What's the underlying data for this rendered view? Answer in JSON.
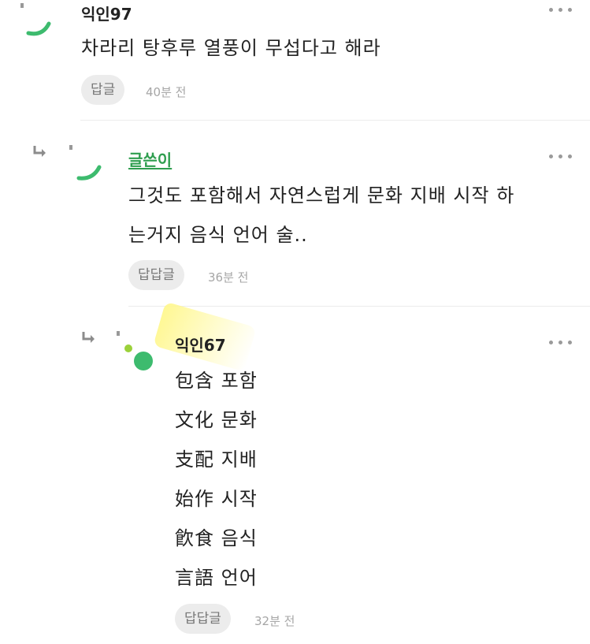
{
  "comments": [
    {
      "nickname": "익인97",
      "lines": [
        "차라리 탕후루 열풍이 무섭다고 해라"
      ],
      "reply_label": "답글",
      "time": "40분 전"
    },
    {
      "nickname": "글쓴이",
      "lines": [
        "그것도 포함해서 자연스럽게 문화 지배 시작 하",
        "는거지 음식 언어 술.."
      ],
      "reply_label": "답답글",
      "time": "36분 전"
    },
    {
      "nickname": "익인67",
      "lines": [
        "包含 포함",
        "文化 문화",
        "支配 지배",
        "始作 시작",
        "飮食 음식",
        "言語 언어"
      ],
      "reply_label": "답답글",
      "time": "32분 전"
    }
  ],
  "colors": {
    "author": "#2f9e4f",
    "avatar_green": "#3dbb6e",
    "avatar_light": "#9bd13a",
    "highlight": "#fff78c"
  },
  "icons": [
    "reply-arrow-icon",
    "more-options-icon"
  ]
}
